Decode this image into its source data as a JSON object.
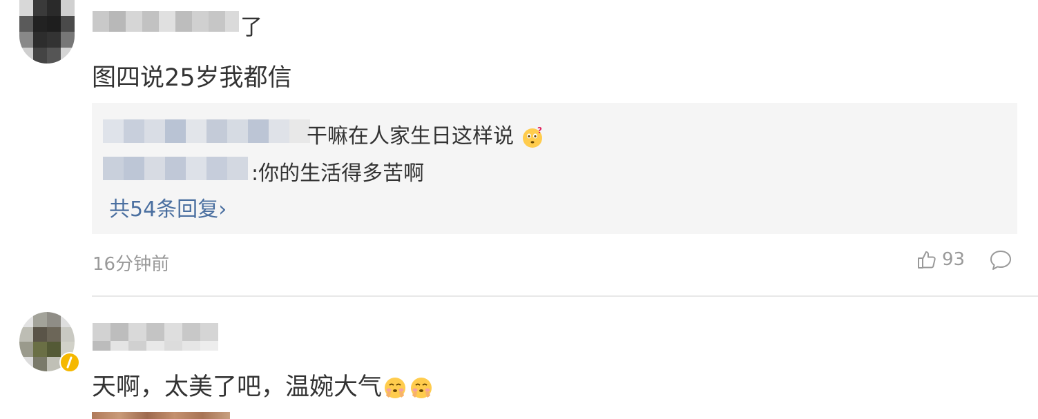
{
  "comments": [
    {
      "username_visible_tail": "了",
      "text": "图四说25岁我都信",
      "replies": [
        {
          "text_visible": "干嘛在人家生日这样说"
        },
        {
          "text_visible": ":你的生活得多苦啊"
        }
      ],
      "more_replies_label": "共54条回复",
      "more_replies_chevron": "›",
      "time": "16分钟前",
      "likes": "93",
      "icons": [
        "thumbs-up-icon",
        "comment-bubble-icon",
        "thinking-emoji-icon"
      ]
    },
    {
      "text": "天啊，太美了吧，温婉大气",
      "icons": [
        "blush-emoji-icon",
        "blush-emoji-icon",
        "verified-badge-icon"
      ]
    }
  ],
  "colors": {
    "link": "#4a6fa0",
    "meta": "#999999",
    "reply_bg": "#f5f5f5",
    "divider": "#e8e8e8",
    "badge": "#f5b800"
  }
}
